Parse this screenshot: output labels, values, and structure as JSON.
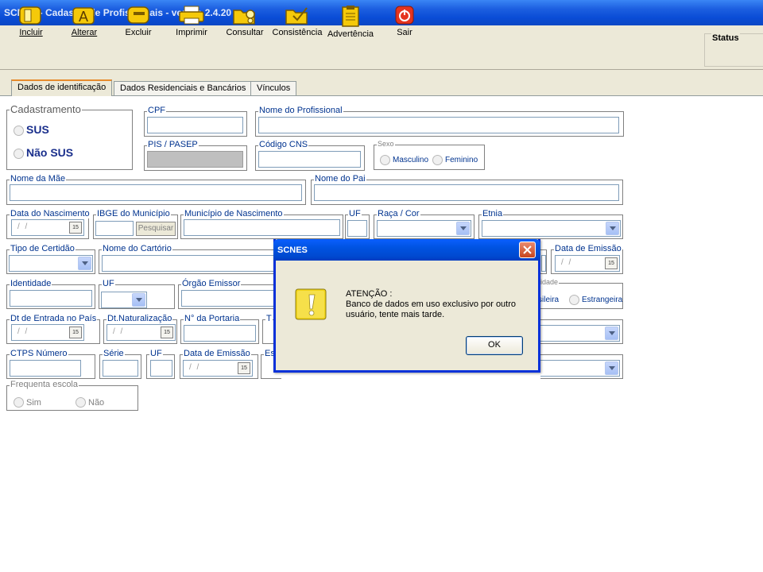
{
  "window": {
    "title": "SCNES - Cadastro de Profissionais - versão 2.4.20"
  },
  "toolbar": {
    "buttons": [
      {
        "label": "Incluir",
        "icon": "door-open-icon"
      },
      {
        "label": "Alterar",
        "icon": "letter-a-icon"
      },
      {
        "label": "Excluir",
        "icon": "door-closed-icon"
      },
      {
        "label": "Imprimir",
        "icon": "printer-icon"
      },
      {
        "label": "Consultar",
        "icon": "folder-search-icon"
      },
      {
        "label": "Consistência",
        "icon": "folder-check-icon"
      },
      {
        "label": "Advertência",
        "icon": "clipboard-icon"
      },
      {
        "label": "Sair",
        "icon": "power-icon"
      }
    ],
    "status_label": "Status"
  },
  "tabs": [
    {
      "label": "Dados de identificação",
      "active": true
    },
    {
      "label": "Dados Residenciais e Bancários",
      "active": false
    },
    {
      "label": "Vínculos",
      "active": false
    }
  ],
  "form": {
    "cadastramento": {
      "label": "Cadastramento",
      "options": [
        "SUS",
        "Não SUS"
      ]
    },
    "cpf": {
      "label": "CPF",
      "value": ""
    },
    "nome_profissional": {
      "label": "Nome do Profissional",
      "value": ""
    },
    "pis_pasep": {
      "label": "PIS / PASEP",
      "value": ""
    },
    "codigo_cns": {
      "label": "Código CNS",
      "value": ""
    },
    "sexo": {
      "label": "Sexo",
      "options": [
        "Masculino",
        "Feminino"
      ]
    },
    "nome_mae": {
      "label": "Nome da Mãe",
      "value": ""
    },
    "nome_pai": {
      "label": "Nome do Pai",
      "value": ""
    },
    "data_nascimento": {
      "label": "Data do Nascimento",
      "placeholder": "/ /"
    },
    "ibge_municipio": {
      "label": "IBGE do Município",
      "button": "Pesquisar"
    },
    "municipio_nascimento": {
      "label": "Município de Nascimento"
    },
    "uf_nascimento": {
      "label": "UF"
    },
    "raca_cor": {
      "label": "Raça / Cor"
    },
    "etnia": {
      "label": "Etnia"
    },
    "tipo_certidao": {
      "label": "Tipo de Certidão"
    },
    "nome_cartorio": {
      "label": "Nome do Cartório"
    },
    "data_emissao_certidao": {
      "label": "Data de Emissão",
      "placeholder": "/ /"
    },
    "identidade": {
      "label": "Identidade"
    },
    "uf_identidade": {
      "label": "UF"
    },
    "orgao_emissor": {
      "label": "Órgão Emissor"
    },
    "nacionalidade": {
      "label": "lidade",
      "options": [
        "sileira",
        "Estrangeira"
      ]
    },
    "dt_entrada_pais": {
      "label": "Dt de Entrada no País",
      "placeholder": "/ /"
    },
    "dt_naturalizacao": {
      "label": "Dt.Naturalização",
      "placeholder": "/ /"
    },
    "n_portaria": {
      "label": "N° da Portaria"
    },
    "partial_label_t": {
      "label": "T"
    },
    "ctps_numero": {
      "label": "CTPS Número"
    },
    "serie": {
      "label": "Série"
    },
    "uf_ctps": {
      "label": "UF"
    },
    "data_emissao_ctps": {
      "label": "Data de Emissão",
      "placeholder": "/ /"
    },
    "partial_label_es": {
      "label": "Es"
    },
    "frequenta_escola": {
      "label": "Frequenta escola",
      "options": [
        "Sim",
        "Não"
      ]
    },
    "calendar_glyph": "15"
  },
  "dialog": {
    "title": "SCNES",
    "heading": "ATENÇÃO :",
    "message": "Banco de dados em uso exclusivo por outro usuário, tente mais tarde.",
    "ok_label": "OK",
    "icon": "warning-icon"
  },
  "colors": {
    "titlebar": "#0a4cd6",
    "label_blue": "#00338f",
    "window_face": "#ece9d8"
  }
}
